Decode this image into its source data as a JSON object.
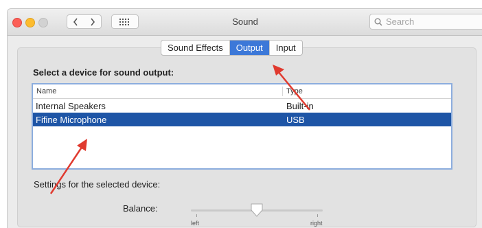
{
  "window": {
    "title": "Sound"
  },
  "search": {
    "placeholder": "Search"
  },
  "tabs": [
    {
      "label": "Sound Effects",
      "active": false
    },
    {
      "label": "Output",
      "active": true
    },
    {
      "label": "Input",
      "active": false
    }
  ],
  "output": {
    "heading": "Select a device for sound output:",
    "columns": {
      "name": "Name",
      "type": "Type"
    },
    "devices": [
      {
        "name": "Internal Speakers",
        "type": "Built-in",
        "selected": false
      },
      {
        "name": "Fifine Microphone",
        "type": "USB",
        "selected": true
      }
    ]
  },
  "settings": {
    "label": "Settings for the selected device:",
    "balance_label": "Balance:",
    "balance_left": "left",
    "balance_right": "right",
    "balance_value": 0.5
  },
  "colors": {
    "selection": "#1e55a6",
    "tab_active": "#3c78d8",
    "annotation_arrow": "#e03a2f"
  },
  "icons": {
    "back": "chevron-left-icon",
    "forward": "chevron-right-icon",
    "grid": "grid-icon",
    "search": "search-icon"
  }
}
